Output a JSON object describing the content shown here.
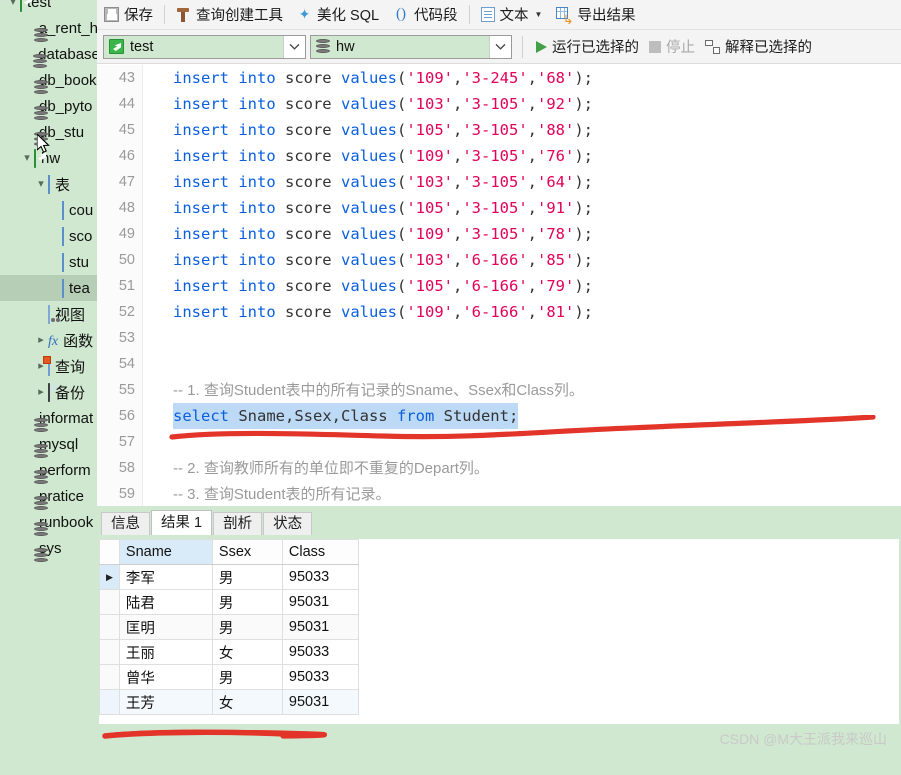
{
  "sidebar": {
    "items": [
      {
        "label": "test",
        "icon": "connection-icon",
        "indent": 0,
        "twisty": "down",
        "selected": false
      },
      {
        "label": "a_rent_h",
        "icon": "database-icon",
        "indent": 1,
        "twisty": "none",
        "selected": false
      },
      {
        "label": "database",
        "icon": "database-icon",
        "indent": 1,
        "twisty": "none",
        "selected": false
      },
      {
        "label": "db_book",
        "icon": "database-icon",
        "indent": 1,
        "twisty": "none",
        "selected": false
      },
      {
        "label": "db_pyto",
        "icon": "database-icon",
        "indent": 1,
        "twisty": "none",
        "selected": false
      },
      {
        "label": "db_stu",
        "icon": "database-icon",
        "indent": 1,
        "twisty": "none",
        "selected": false
      },
      {
        "label": "hw",
        "icon": "connection-icon",
        "indent": 1,
        "twisty": "down",
        "selected": false
      },
      {
        "label": "表",
        "icon": "table-icon",
        "indent": 2,
        "twisty": "down",
        "selected": false
      },
      {
        "label": "cou",
        "icon": "table-icon",
        "indent": 3,
        "twisty": "none",
        "selected": false
      },
      {
        "label": "sco",
        "icon": "table-icon",
        "indent": 3,
        "twisty": "none",
        "selected": false
      },
      {
        "label": "stu",
        "icon": "table-icon",
        "indent": 3,
        "twisty": "none",
        "selected": false
      },
      {
        "label": "tea",
        "icon": "table-icon",
        "indent": 3,
        "twisty": "none",
        "selected": true
      },
      {
        "label": "视图",
        "icon": "view-icon",
        "indent": 2,
        "twisty": "none",
        "selected": false
      },
      {
        "label": "函数",
        "icon": "function-icon",
        "indent": 2,
        "twisty": "right",
        "selected": false
      },
      {
        "label": "查询",
        "icon": "query-icon",
        "indent": 2,
        "twisty": "right",
        "selected": false
      },
      {
        "label": "备份",
        "icon": "backup-icon",
        "indent": 2,
        "twisty": "right",
        "selected": false
      },
      {
        "label": "informat",
        "icon": "database-icon",
        "indent": 1,
        "twisty": "none",
        "selected": false
      },
      {
        "label": "mysql",
        "icon": "database-icon",
        "indent": 1,
        "twisty": "none",
        "selected": false
      },
      {
        "label": "perform",
        "icon": "database-icon",
        "indent": 1,
        "twisty": "none",
        "selected": false
      },
      {
        "label": "pratice",
        "icon": "database-icon",
        "indent": 1,
        "twisty": "none",
        "selected": false
      },
      {
        "label": "runbook",
        "icon": "database-icon",
        "indent": 1,
        "twisty": "none",
        "selected": false
      },
      {
        "label": "sys",
        "icon": "database-icon",
        "indent": 1,
        "twisty": "none",
        "selected": false
      }
    ]
  },
  "toolbar": {
    "save_label": "保存",
    "query_builder_label": "查询创建工具",
    "beautify_label": "美化 SQL",
    "snippet_label": "代码段",
    "text_label": "文本",
    "export_label": "导出结果"
  },
  "selectbar": {
    "connection_value": "test",
    "database_value": "hw",
    "run_selected_label": "运行已选择的",
    "stop_label": "停止",
    "explain_selected_label": "解释已选择的"
  },
  "editor": {
    "lines": [
      {
        "num": "43",
        "tokens": [
          {
            "t": "k",
            "v": "insert into "
          },
          {
            "t": "id",
            "v": "score "
          },
          {
            "t": "k",
            "v": "values"
          },
          {
            "t": "p",
            "v": "("
          },
          {
            "t": "s",
            "v": "'109'"
          },
          {
            "t": "p",
            "v": ","
          },
          {
            "t": "s",
            "v": "'3-245'"
          },
          {
            "t": "p",
            "v": ","
          },
          {
            "t": "s",
            "v": "'68'"
          },
          {
            "t": "p",
            "v": ");"
          }
        ]
      },
      {
        "num": "44",
        "tokens": [
          {
            "t": "k",
            "v": "insert into "
          },
          {
            "t": "id",
            "v": "score "
          },
          {
            "t": "k",
            "v": "values"
          },
          {
            "t": "p",
            "v": "("
          },
          {
            "t": "s",
            "v": "'103'"
          },
          {
            "t": "p",
            "v": ","
          },
          {
            "t": "s",
            "v": "'3-105'"
          },
          {
            "t": "p",
            "v": ","
          },
          {
            "t": "s",
            "v": "'92'"
          },
          {
            "t": "p",
            "v": ");"
          }
        ]
      },
      {
        "num": "45",
        "tokens": [
          {
            "t": "k",
            "v": "insert into "
          },
          {
            "t": "id",
            "v": "score "
          },
          {
            "t": "k",
            "v": "values"
          },
          {
            "t": "p",
            "v": "("
          },
          {
            "t": "s",
            "v": "'105'"
          },
          {
            "t": "p",
            "v": ","
          },
          {
            "t": "s",
            "v": "'3-105'"
          },
          {
            "t": "p",
            "v": ","
          },
          {
            "t": "s",
            "v": "'88'"
          },
          {
            "t": "p",
            "v": ");"
          }
        ]
      },
      {
        "num": "46",
        "tokens": [
          {
            "t": "k",
            "v": "insert into "
          },
          {
            "t": "id",
            "v": "score "
          },
          {
            "t": "k",
            "v": "values"
          },
          {
            "t": "p",
            "v": "("
          },
          {
            "t": "s",
            "v": "'109'"
          },
          {
            "t": "p",
            "v": ","
          },
          {
            "t": "s",
            "v": "'3-105'"
          },
          {
            "t": "p",
            "v": ","
          },
          {
            "t": "s",
            "v": "'76'"
          },
          {
            "t": "p",
            "v": ");"
          }
        ]
      },
      {
        "num": "47",
        "tokens": [
          {
            "t": "k",
            "v": "insert into "
          },
          {
            "t": "id",
            "v": "score "
          },
          {
            "t": "k",
            "v": "values"
          },
          {
            "t": "p",
            "v": "("
          },
          {
            "t": "s",
            "v": "'103'"
          },
          {
            "t": "p",
            "v": ","
          },
          {
            "t": "s",
            "v": "'3-105'"
          },
          {
            "t": "p",
            "v": ","
          },
          {
            "t": "s",
            "v": "'64'"
          },
          {
            "t": "p",
            "v": ");"
          }
        ]
      },
      {
        "num": "48",
        "tokens": [
          {
            "t": "k",
            "v": "insert into "
          },
          {
            "t": "id",
            "v": "score "
          },
          {
            "t": "k",
            "v": "values"
          },
          {
            "t": "p",
            "v": "("
          },
          {
            "t": "s",
            "v": "'105'"
          },
          {
            "t": "p",
            "v": ","
          },
          {
            "t": "s",
            "v": "'3-105'"
          },
          {
            "t": "p",
            "v": ","
          },
          {
            "t": "s",
            "v": "'91'"
          },
          {
            "t": "p",
            "v": ");"
          }
        ]
      },
      {
        "num": "49",
        "tokens": [
          {
            "t": "k",
            "v": "insert into "
          },
          {
            "t": "id",
            "v": "score "
          },
          {
            "t": "k",
            "v": "values"
          },
          {
            "t": "p",
            "v": "("
          },
          {
            "t": "s",
            "v": "'109'"
          },
          {
            "t": "p",
            "v": ","
          },
          {
            "t": "s",
            "v": "'3-105'"
          },
          {
            "t": "p",
            "v": ","
          },
          {
            "t": "s",
            "v": "'78'"
          },
          {
            "t": "p",
            "v": ");"
          }
        ]
      },
      {
        "num": "50",
        "tokens": [
          {
            "t": "k",
            "v": "insert into "
          },
          {
            "t": "id",
            "v": "score "
          },
          {
            "t": "k",
            "v": "values"
          },
          {
            "t": "p",
            "v": "("
          },
          {
            "t": "s",
            "v": "'103'"
          },
          {
            "t": "p",
            "v": ","
          },
          {
            "t": "s",
            "v": "'6-166'"
          },
          {
            "t": "p",
            "v": ","
          },
          {
            "t": "s",
            "v": "'85'"
          },
          {
            "t": "p",
            "v": ");"
          }
        ]
      },
      {
        "num": "51",
        "tokens": [
          {
            "t": "k",
            "v": "insert into "
          },
          {
            "t": "id",
            "v": "score "
          },
          {
            "t": "k",
            "v": "values"
          },
          {
            "t": "p",
            "v": "("
          },
          {
            "t": "s",
            "v": "'105'"
          },
          {
            "t": "p",
            "v": ","
          },
          {
            "t": "s",
            "v": "'6-166'"
          },
          {
            "t": "p",
            "v": ","
          },
          {
            "t": "s",
            "v": "'79'"
          },
          {
            "t": "p",
            "v": ");"
          }
        ]
      },
      {
        "num": "52",
        "tokens": [
          {
            "t": "k",
            "v": "insert into "
          },
          {
            "t": "id",
            "v": "score "
          },
          {
            "t": "k",
            "v": "values"
          },
          {
            "t": "p",
            "v": "("
          },
          {
            "t": "s",
            "v": "'109'"
          },
          {
            "t": "p",
            "v": ","
          },
          {
            "t": "s",
            "v": "'6-166'"
          },
          {
            "t": "p",
            "v": ","
          },
          {
            "t": "s",
            "v": "'81'"
          },
          {
            "t": "p",
            "v": ");"
          }
        ]
      },
      {
        "num": "53",
        "tokens": []
      },
      {
        "num": "54",
        "tokens": []
      },
      {
        "num": "55",
        "tokens": [
          {
            "t": "cm",
            "v": "-- 1. 查询Student表中的所有记录的Sname、Ssex和Class列。"
          }
        ]
      },
      {
        "num": "56",
        "selected": true,
        "tokens": [
          {
            "t": "k",
            "v": "select "
          },
          {
            "t": "id",
            "v": "Sname,Ssex,Class "
          },
          {
            "t": "k",
            "v": "from "
          },
          {
            "t": "id",
            "v": "Student;"
          }
        ]
      },
      {
        "num": "57",
        "tokens": []
      },
      {
        "num": "58",
        "tokens": [
          {
            "t": "cm",
            "v": "-- 2. 查询教师所有的单位即不重复的Depart列。"
          }
        ]
      },
      {
        "num": "59",
        "tokens": [
          {
            "t": "cm",
            "v": "-- 3. 查询Student表的所有记录。"
          }
        ]
      }
    ]
  },
  "result": {
    "tabs": [
      {
        "label": "信息",
        "active": false
      },
      {
        "label": "结果 1",
        "active": true
      },
      {
        "label": "剖析",
        "active": false
      },
      {
        "label": "状态",
        "active": false
      }
    ],
    "columns": [
      "Sname",
      "Ssex",
      "Class"
    ],
    "rows": [
      {
        "current": true,
        "cells": [
          "李军",
          "男",
          "95033"
        ]
      },
      {
        "current": false,
        "cells": [
          "陆君",
          "男",
          "95031"
        ]
      },
      {
        "current": false,
        "cells": [
          "匡明",
          "男",
          "95031"
        ]
      },
      {
        "current": false,
        "cells": [
          "王丽",
          "女",
          "95033"
        ]
      },
      {
        "current": false,
        "cells": [
          "曾华",
          "男",
          "95033"
        ]
      },
      {
        "current": false,
        "cells": [
          "王芳",
          "女",
          "95031"
        ]
      }
    ]
  },
  "watermark": {
    "text": "CSDN @M大王派我来巡山"
  },
  "colors": {
    "sidebar_bg": "#cfe8cf",
    "accent_green": "#44a047",
    "keyword_blue": "#0a5fe0",
    "string_pink": "#e2005a",
    "selection_blue": "#bcd9f5",
    "annotation_red": "#e3342a"
  }
}
